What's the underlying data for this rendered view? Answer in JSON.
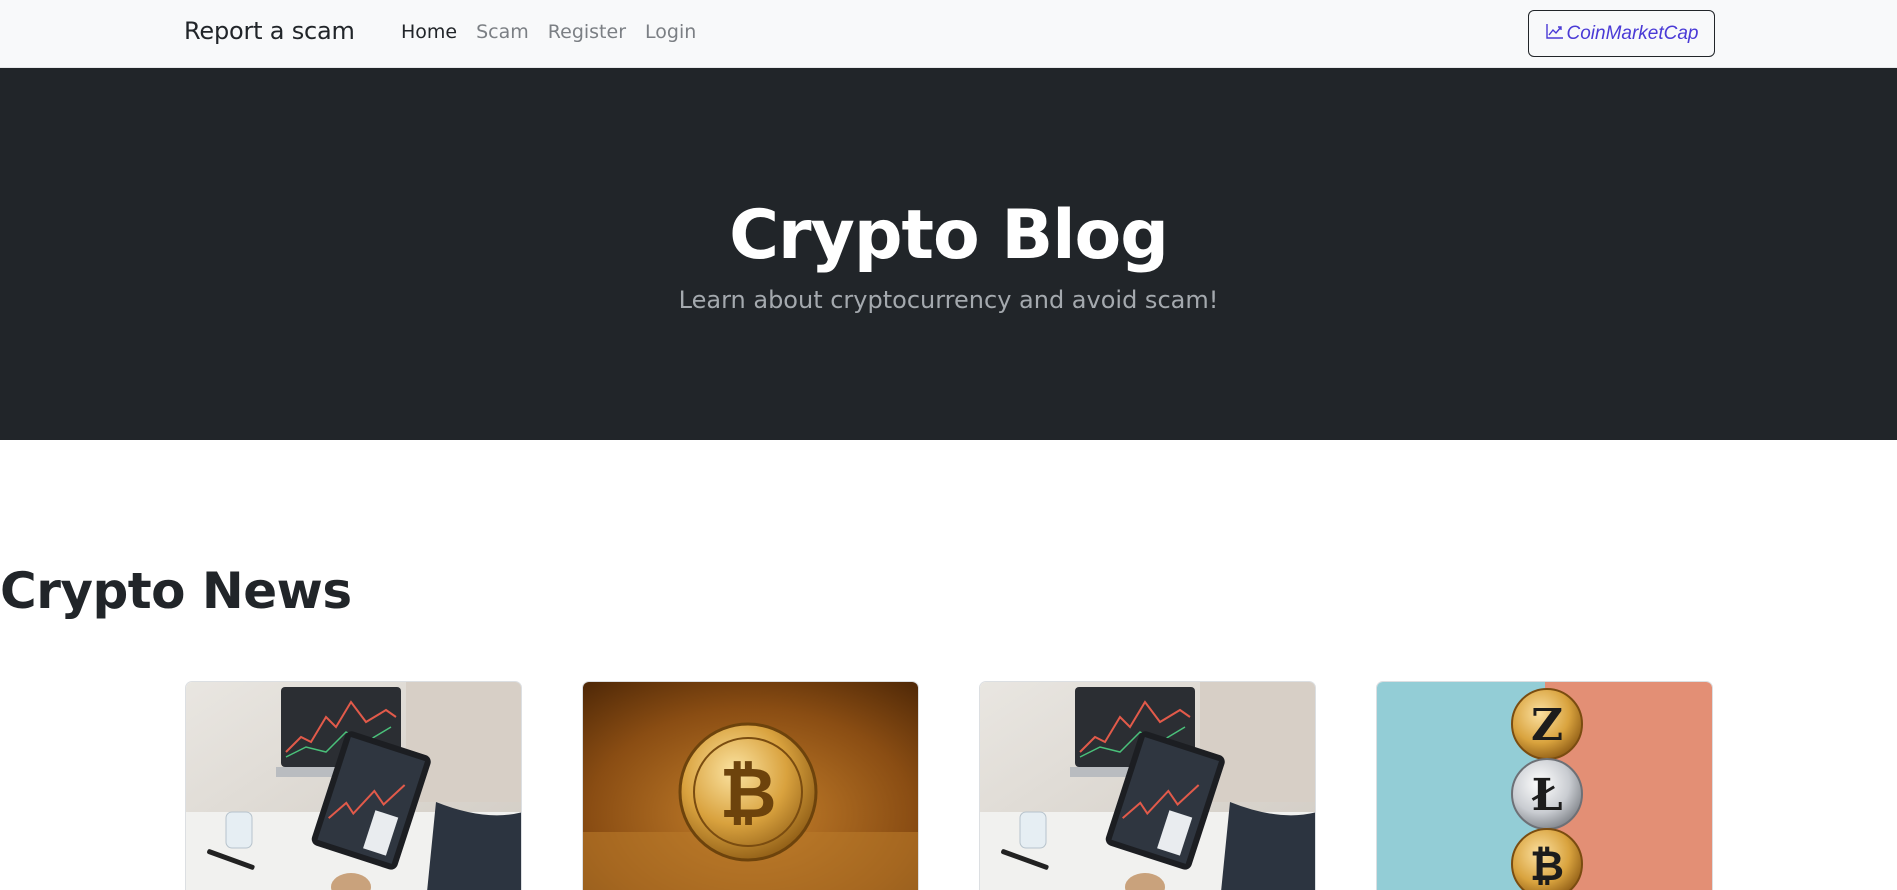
{
  "navbar": {
    "brand": "Report a scam",
    "links": [
      {
        "label": "Home",
        "active": true
      },
      {
        "label": "Scam",
        "active": false
      },
      {
        "label": "Register",
        "active": false
      },
      {
        "label": "Login",
        "active": false
      }
    ],
    "cta": {
      "label": "CoinMarketCap",
      "icon": "chart-line-icon"
    }
  },
  "hero": {
    "title": "Crypto Blog",
    "subtitle": "Learn about cryptocurrency and avoid scam!"
  },
  "news": {
    "heading": "Crypto News",
    "cards": [
      {
        "image": "trading-tablet-photo"
      },
      {
        "image": "bitcoin-coin-photo"
      },
      {
        "image": "trading-tablet-photo"
      },
      {
        "image": "stacked-crypto-coins-photo"
      }
    ]
  },
  "colors": {
    "navbar_bg": "#f8f9fa",
    "hero_bg": "#212529",
    "cta_text": "#4a3ad6"
  }
}
